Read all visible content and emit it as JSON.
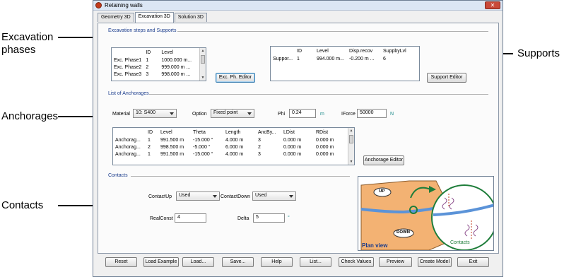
{
  "callouts": {
    "excavation_line1": "Excavation",
    "excavation_line2": "phases",
    "supports": "Supports",
    "anchorages": "Anchorages",
    "contacts": "Contacts"
  },
  "window": {
    "title": "Retaining walls",
    "close_glyph": "✕"
  },
  "tabs": [
    "Geometry 3D",
    "Excavation 3D",
    "Solution 3D"
  ],
  "excavation": {
    "group_title": "Excavation steps and Supports",
    "phases_columns": [
      "",
      "ID",
      "Level"
    ],
    "phases_rows": [
      [
        "Exc. Phase1",
        "1",
        "1000.000 m..."
      ],
      [
        "Exc. Phase2",
        "2",
        "999.000 m ..."
      ],
      [
        "Exc. Phase3",
        "3",
        "998.000 m ..."
      ]
    ],
    "phase_editor_label": "Exc. Ph. Editor",
    "supports_columns": [
      "",
      "ID",
      "Level",
      "Disp.recov",
      "SuppbyLvl"
    ],
    "supports_rows": [
      [
        "Suppor...",
        "1",
        "994.000 m...",
        "-0.200 m ...",
        "6"
      ]
    ],
    "support_editor_label": "Support Editor"
  },
  "anchorages": {
    "group_title": "List of Anchorages",
    "material_label": "Material",
    "material_value": "10: S400",
    "option_label": "Option",
    "option_value": "Fixed point",
    "phi_label": "Phi",
    "phi_value": "0.24",
    "phi_unit": "m",
    "iforce_label": "IForce",
    "iforce_value": "50000",
    "iforce_unit": "N",
    "columns": [
      "",
      "ID",
      "Level",
      "Theta",
      "Length",
      "AncBy...",
      "LDist",
      "RDist"
    ],
    "rows": [
      [
        "Anchorag...",
        "1",
        "991.500 m",
        "-15.000 °",
        "4.000 m",
        "3",
        "0.000 m",
        "0.000 m"
      ],
      [
        "Anchorag...",
        "2",
        "998.500 m",
        "-5.000 °",
        "6.000 m",
        "2",
        "0.000 m",
        "0.000 m"
      ],
      [
        "Anchorag...",
        "1",
        "991.500 m",
        "-15.000 °",
        "4.000 m",
        "3",
        "0.000 m",
        "0.000 m"
      ]
    ],
    "editor_label": "Anchorage Editor"
  },
  "contacts": {
    "group_title": "Contacts",
    "contact_up_label": "ContactUp",
    "contact_up_value": "Used",
    "contact_down_label": "ContactDown",
    "contact_down_value": "Used",
    "realconst_label": "RealConst",
    "realconst_value": "4",
    "delta_label": "Delta",
    "delta_value": "5",
    "delta_unit": "°"
  },
  "plan_view": {
    "up_label": "UP",
    "down_label": "DOWN",
    "contacts_label": "Contacts",
    "title": "Plan view",
    "colors": {
      "ground": "#f3b273",
      "wall": "#5b93d8",
      "highlight": "#1e7d3a"
    }
  },
  "bottom_buttons": [
    "Reset",
    "Load Example",
    "Load...",
    "Save...",
    "Help",
    "List...",
    "Check Values",
    "Preview",
    "Create Model",
    "Exit"
  ]
}
